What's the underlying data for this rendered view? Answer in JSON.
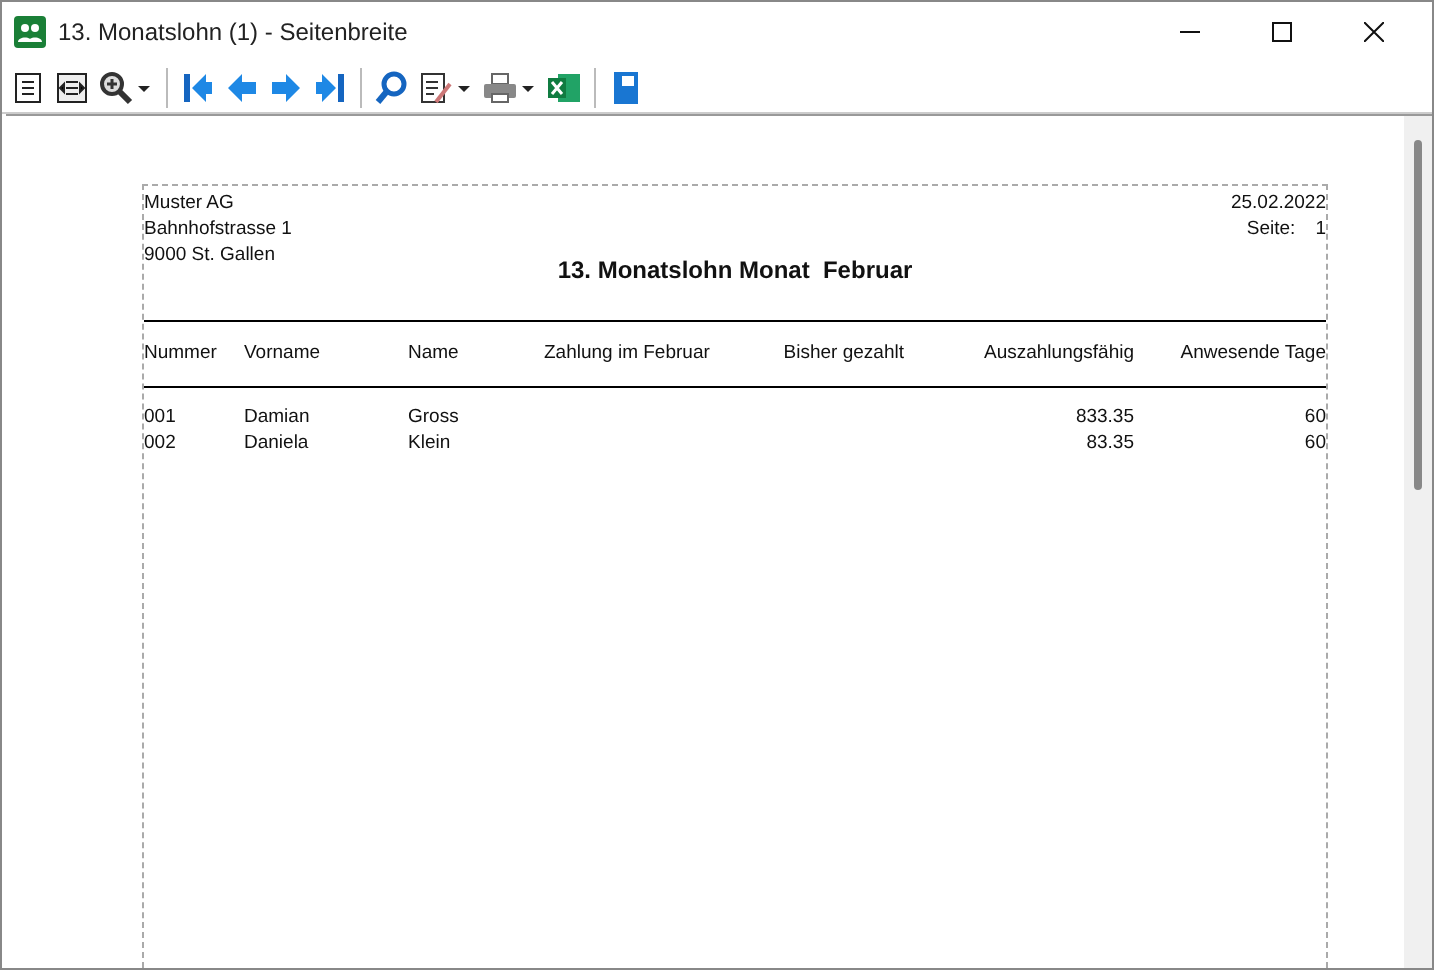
{
  "window": {
    "title": "13. Monatslohn (1) - Seitenbreite"
  },
  "toolbar": [
    {
      "kind": "page"
    },
    {
      "kind": "fit"
    },
    {
      "kind": "zoom",
      "dropdown": true
    },
    {
      "kind": "sep"
    },
    {
      "kind": "first"
    },
    {
      "kind": "prev"
    },
    {
      "kind": "next"
    },
    {
      "kind": "last"
    },
    {
      "kind": "sep"
    },
    {
      "kind": "search"
    },
    {
      "kind": "edit",
      "dropdown": true
    },
    {
      "kind": "print",
      "dropdown": true
    },
    {
      "kind": "excel"
    },
    {
      "kind": "sep"
    },
    {
      "kind": "save"
    }
  ],
  "report": {
    "company": [
      "Muster AG",
      "Bahnhofstrasse 1",
      "9000 St. Gallen"
    ],
    "date": "25.02.2022",
    "page_label": "Seite:",
    "page_number": "1",
    "title": "13. Monatslohn Monat  Februar",
    "columns": [
      "Nummer",
      "Vorname",
      "Name",
      "Zahlung im Februar",
      "Bisher gezahlt",
      "Auszahlungsfähig",
      "Anwesende Tage"
    ],
    "rows": [
      [
        "001",
        "Damian",
        "Gross",
        "",
        "",
        "833.35",
        "60"
      ],
      [
        "002",
        "Daniela",
        "Klein",
        "",
        "",
        "83.35",
        "60"
      ]
    ]
  }
}
